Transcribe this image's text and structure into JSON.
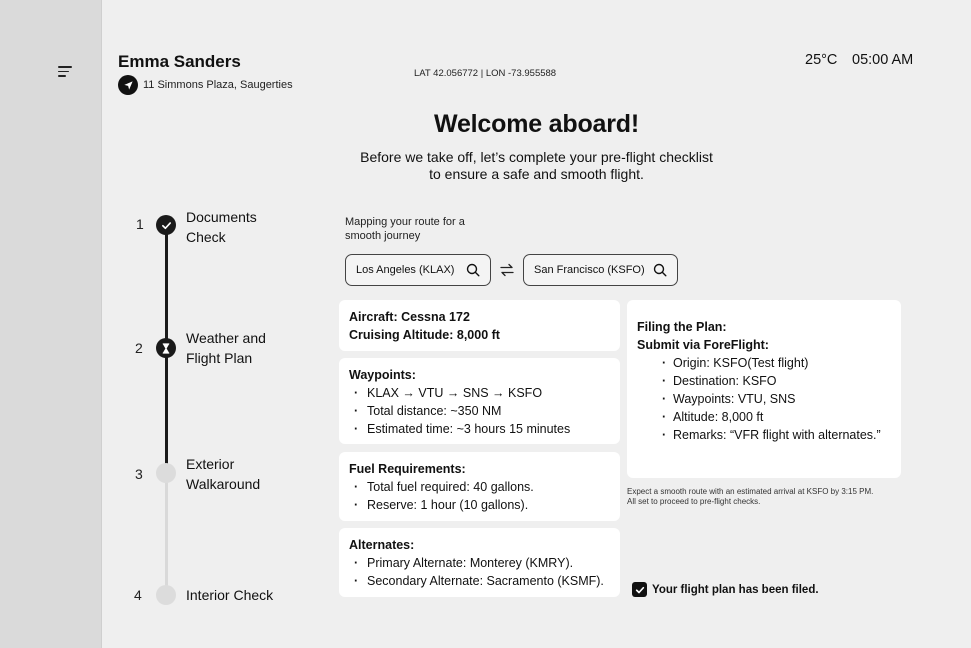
{
  "header": {
    "user_name": "Emma Sanders",
    "address": "11 Simmons Plaza, Saugerties",
    "coordinates": "LAT 42.056772 | LON -73.955588",
    "temperature": "25°C",
    "time": "05:00 AM"
  },
  "hero": {
    "title": "Welcome aboard!",
    "subtitle_line1": "Before we take off, let’s complete your pre-flight checklist",
    "subtitle_line2": "to ensure a safe and smooth flight."
  },
  "steps": [
    {
      "number": "1",
      "line1": "Documents",
      "line2": "Check",
      "status": "completed"
    },
    {
      "number": "2",
      "line1": "Weather and",
      "line2": "Flight Plan",
      "status": "in-progress"
    },
    {
      "number": "3",
      "line1": "Exterior",
      "line2": "Walkaround",
      "status": "pending"
    },
    {
      "number": "4",
      "line1": "Interior Check",
      "line2": "",
      "status": "pending"
    }
  ],
  "route": {
    "caption_line1": "Mapping your route for a",
    "caption_line2": "smooth journey",
    "origin_value": "Los Angeles (KLAX)",
    "destination_value": "San Francisco (KSFO)"
  },
  "aircraft": {
    "aircraft_line": "Aircraft: Cessna 172",
    "altitude_line": "Cruising Altitude: 8,000 ft"
  },
  "waypoints": {
    "heading": "Waypoints:",
    "items": [
      "KLAX → VTU → SNS → KSFO",
      "Total distance: ~350 NM",
      "Estimated time: ~3 hours 15 minutes"
    ]
  },
  "fuel": {
    "heading": "Fuel Requirements:",
    "items": [
      "Total fuel required: 40 gallons.",
      "Reserve: 1 hour (10 gallons)."
    ]
  },
  "alternates": {
    "heading": "Alternates:",
    "items": [
      "Primary Alternate: Monterey (KMRY).",
      "Secondary Alternate: Sacramento (KSMF)."
    ]
  },
  "filing": {
    "heading1": "Filing the Plan:",
    "heading2": "Submit via ForeFlight:",
    "items": [
      "Origin: KSFO(Test flight)",
      "Destination: KSFO",
      "Waypoints: VTU, SNS",
      "Altitude: 8,000 ft",
      "Remarks: “VFR flight with alternates.”"
    ]
  },
  "footnote": {
    "line1": "Expect a smooth route with an estimated arrival at KSFO by 3:15 PM.",
    "line2": "All set to proceed to pre-flight checks."
  },
  "confirmation": {
    "text": "Your flight plan has been filed.",
    "checked": true
  },
  "colors": {
    "sidebar": "#dadada",
    "background": "#efefef",
    "card": "#ffffff",
    "progress_active": "#1a1a1a",
    "progress_inactive": "#d9d9d9"
  },
  "icons": [
    "menu-icon",
    "navigation-arrow-icon",
    "search-icon",
    "swap-arrows-icon",
    "check-icon",
    "hourglass-icon",
    "checkbox-check-icon"
  ]
}
